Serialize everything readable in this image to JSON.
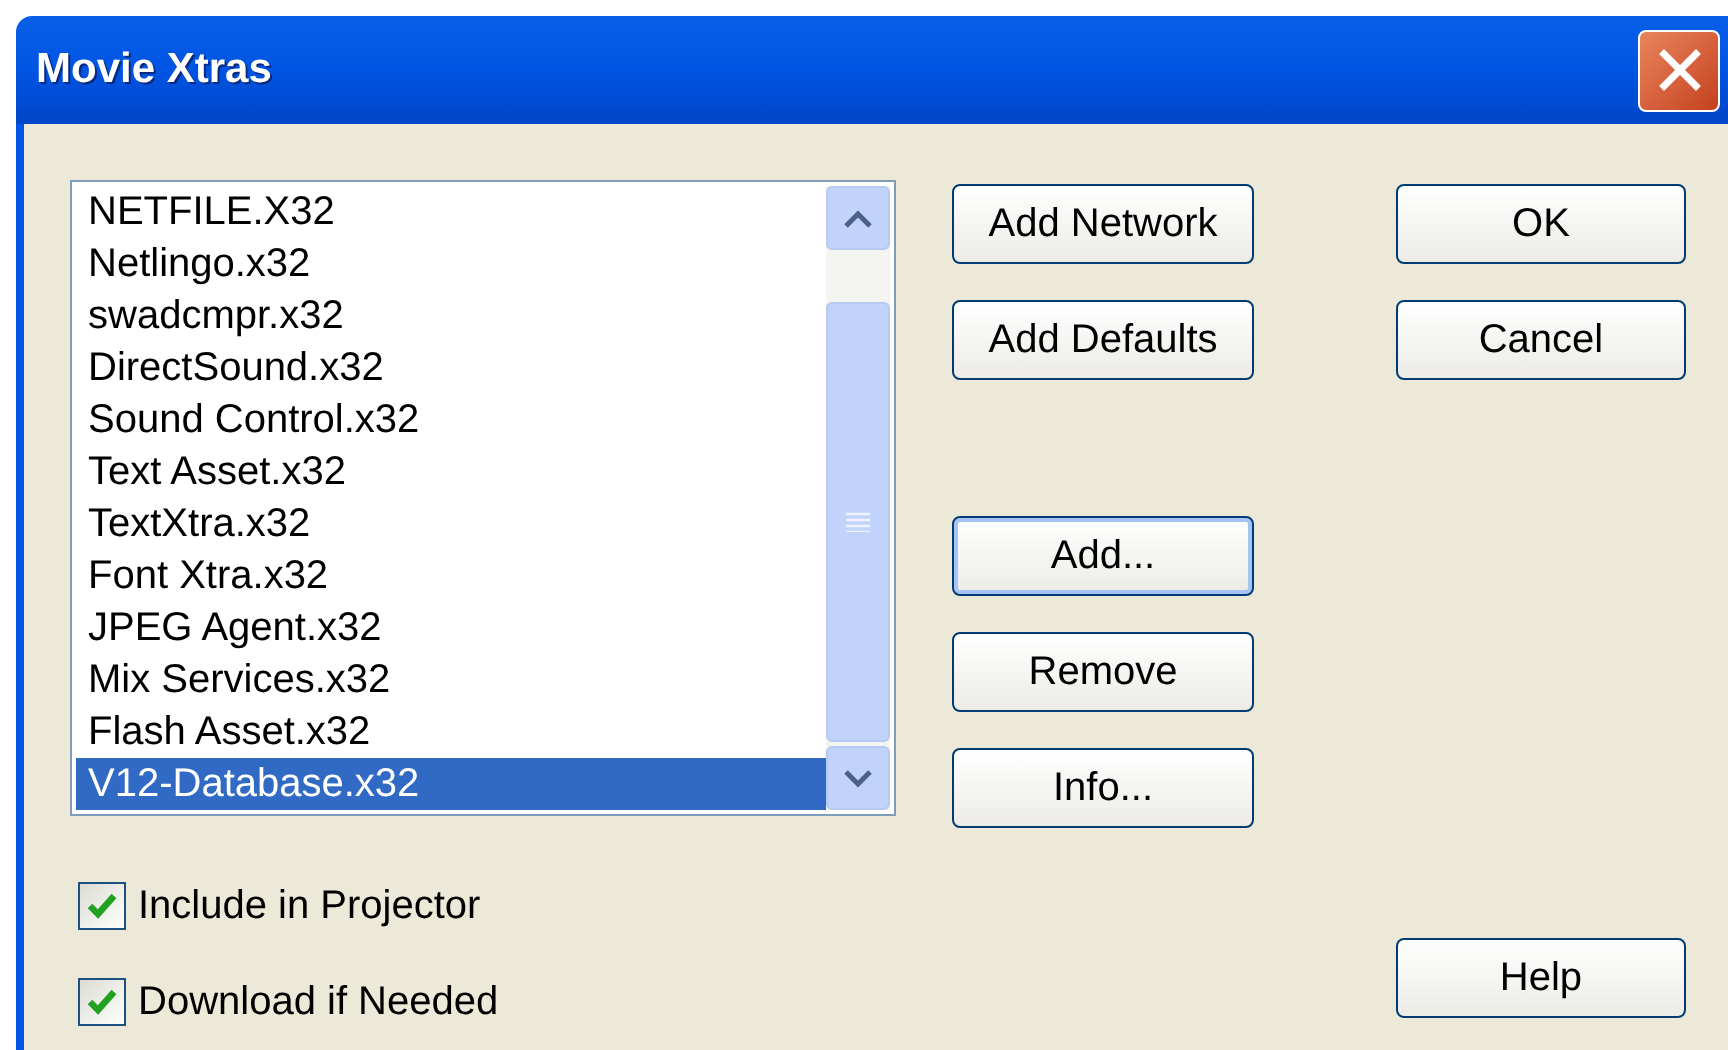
{
  "window": {
    "title": "Movie Xtras"
  },
  "xtras": [
    {
      "label": "NETFILE.X32",
      "selected": false
    },
    {
      "label": "Netlingo.x32",
      "selected": false
    },
    {
      "label": "swadcmpr.x32",
      "selected": false
    },
    {
      "label": "DirectSound.x32",
      "selected": false
    },
    {
      "label": "Sound Control.x32",
      "selected": false
    },
    {
      "label": "Text Asset.x32",
      "selected": false
    },
    {
      "label": "TextXtra.x32",
      "selected": false
    },
    {
      "label": "Font Xtra.x32",
      "selected": false
    },
    {
      "label": "JPEG Agent.x32",
      "selected": false
    },
    {
      "label": "Mix Services.x32",
      "selected": false
    },
    {
      "label": "Flash Asset.x32",
      "selected": false
    },
    {
      "label": "V12-Database.x32",
      "selected": true
    }
  ],
  "xtra_buttons": [
    {
      "label": "Add Network",
      "focused": false
    },
    {
      "label": "Add Defaults",
      "focused": false
    },
    {
      "label": "Add...",
      "focused": true
    },
    {
      "label": "Remove",
      "focused": false
    },
    {
      "label": "Info...",
      "focused": false
    }
  ],
  "dialog_buttons": [
    {
      "label": "OK"
    },
    {
      "label": "Cancel"
    }
  ],
  "options": [
    {
      "label": "Include in Projector",
      "checked": true
    },
    {
      "label": "Download if Needed",
      "checked": true
    }
  ],
  "help_button": {
    "label": "Help"
  }
}
